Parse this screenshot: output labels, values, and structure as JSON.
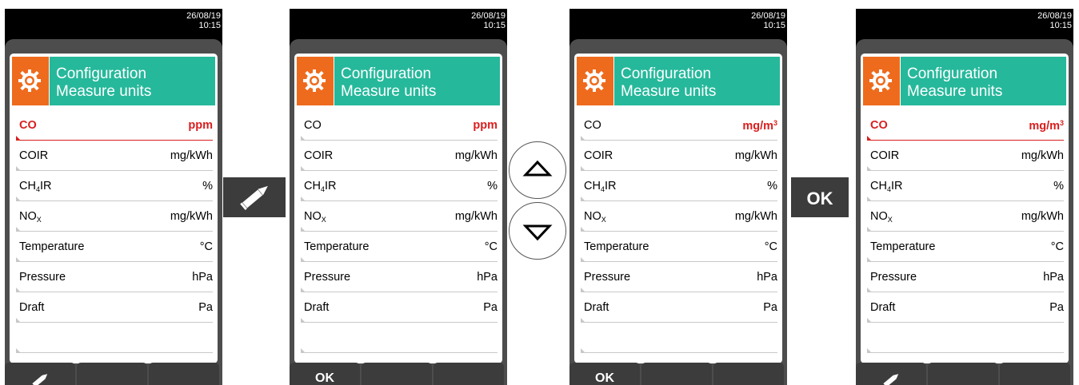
{
  "screens": [
    {
      "datetime": [
        "26/08/19",
        "10:15"
      ],
      "header": [
        "Configuration",
        "Measure units"
      ],
      "rows": [
        {
          "label": "CO",
          "value": "ppm",
          "selected": true
        },
        {
          "label": "COIR",
          "value": "mg/kWh"
        },
        {
          "label": "CH",
          "label_sub": "4",
          "label_tail": "IR",
          "value": "%"
        },
        {
          "label": "NO",
          "label_sub": "X",
          "value": "mg/kWh"
        },
        {
          "label": "Temperature",
          "value": "°C"
        },
        {
          "label": "Pressure",
          "value": "hPa"
        },
        {
          "label": "Draft",
          "value": "Pa"
        },
        {
          "label": "",
          "value": ""
        }
      ],
      "softkeys": [
        {
          "icon": "pencil-icon",
          "label": ""
        },
        {
          "label": ""
        },
        {
          "label": ""
        }
      ]
    },
    {
      "datetime": [
        "26/08/19",
        "10:15"
      ],
      "header": [
        "Configuration",
        "Measure units"
      ],
      "rows": [
        {
          "label": "CO",
          "value": "ppm",
          "value_red": true
        },
        {
          "label": "COIR",
          "value": "mg/kWh"
        },
        {
          "label": "CH",
          "label_sub": "4",
          "label_tail": "IR",
          "value": "%"
        },
        {
          "label": "NO",
          "label_sub": "X",
          "value": "mg/kWh"
        },
        {
          "label": "Temperature",
          "value": "°C"
        },
        {
          "label": "Pressure",
          "value": "hPa"
        },
        {
          "label": "Draft",
          "value": "Pa"
        },
        {
          "label": "",
          "value": ""
        }
      ],
      "softkeys": [
        {
          "label": "OK"
        },
        {
          "label": ""
        },
        {
          "label": ""
        }
      ]
    },
    {
      "datetime": [
        "26/08/19",
        "10:15"
      ],
      "header": [
        "Configuration",
        "Measure units"
      ],
      "rows": [
        {
          "label": "CO",
          "value": "mg/m",
          "value_sup": "3",
          "value_red": true
        },
        {
          "label": "COIR",
          "value": "mg/kWh"
        },
        {
          "label": "CH",
          "label_sub": "4",
          "label_tail": "IR",
          "value": "%"
        },
        {
          "label": "NO",
          "label_sub": "X",
          "value": "mg/kWh"
        },
        {
          "label": "Temperature",
          "value": "°C"
        },
        {
          "label": "Pressure",
          "value": "hPa"
        },
        {
          "label": "Draft",
          "value": "Pa"
        },
        {
          "label": "",
          "value": ""
        }
      ],
      "softkeys": [
        {
          "label": "OK"
        },
        {
          "label": ""
        },
        {
          "label": ""
        }
      ]
    },
    {
      "datetime": [
        "26/08/19",
        "10:15"
      ],
      "header": [
        "Configuration",
        "Measure units"
      ],
      "rows": [
        {
          "label": "CO",
          "value": "mg/m",
          "value_sup": "3",
          "selected": true
        },
        {
          "label": "COIR",
          "value": "mg/kWh"
        },
        {
          "label": "CH",
          "label_sub": "4",
          "label_tail": "IR",
          "value": "%"
        },
        {
          "label": "NO",
          "label_sub": "X",
          "value": "mg/kWh"
        },
        {
          "label": "Temperature",
          "value": "°C"
        },
        {
          "label": "Pressure",
          "value": "hPa"
        },
        {
          "label": "Draft",
          "value": "Pa"
        },
        {
          "label": "",
          "value": ""
        }
      ],
      "softkeys": [
        {
          "icon": "pencil-icon",
          "label": ""
        },
        {
          "label": ""
        },
        {
          "label": ""
        }
      ]
    }
  ],
  "between": [
    {
      "type": "pencil-icon"
    },
    {
      "type": "arrow-buttons",
      "up": "arrow-up-icon",
      "down": "arrow-down-icon"
    },
    {
      "type": "ok-button",
      "label": "OK"
    }
  ],
  "colors": {
    "accent_orange": "#ee6b1d",
    "header_teal": "#26b89b",
    "selection_red": "#d91e1e"
  }
}
